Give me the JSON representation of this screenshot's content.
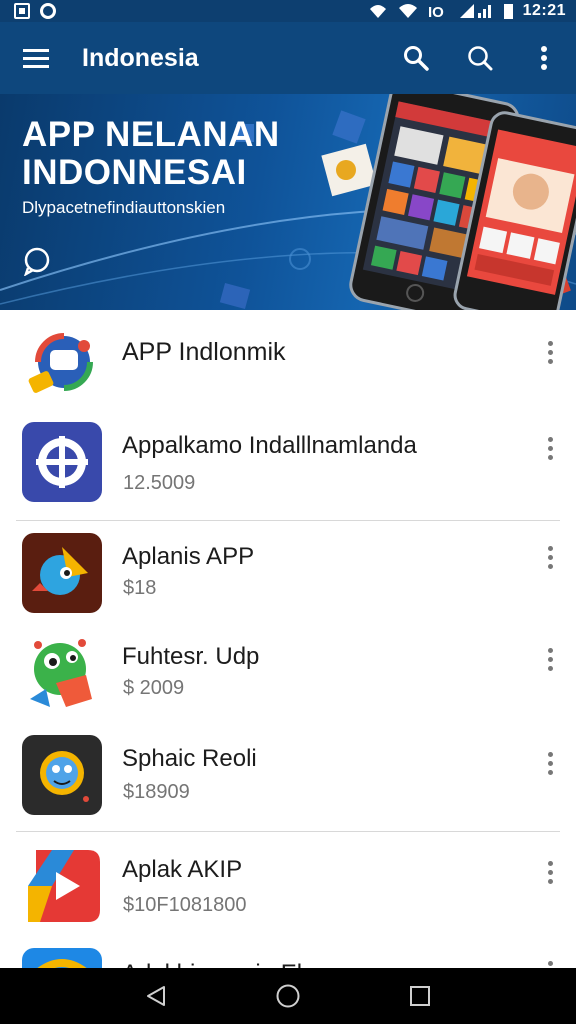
{
  "status_bar": {
    "time": "12:21",
    "left_icons": [
      "screenshot-icon",
      "sync-icon"
    ],
    "right_icons": [
      "wifi-calling-icon",
      "wifi-icon",
      "alarm-icon",
      "signal-icon",
      "battery-icon"
    ]
  },
  "toolbar": {
    "title": "Indonesia",
    "menu_icon": "hamburger-menu-icon",
    "actions": [
      "search-icon",
      "search-icon",
      "more-vert-icon"
    ]
  },
  "banner": {
    "title_line1": "APP NELANAN",
    "title_line2": "INDONNESAI",
    "subtitle": "Dlypacetnefindiauttonskien",
    "colors": {
      "dark": "#0a3a6c",
      "mid": "#1565b0"
    }
  },
  "apps": [
    {
      "name": "APP  Indlonmik",
      "price": "",
      "icon": "chat-bubbles-app-icon"
    },
    {
      "name": "Appalkamo Indalllnamlanda",
      "price": "12.5009",
      "icon": "globe-compass-app-icon"
    },
    {
      "name": "Aplanis APP",
      "price": "$18",
      "icon": "bird-app-icon"
    },
    {
      "name": "Fuhtesr. Udp",
      "price": "$ 2009",
      "icon": "green-monster-app-icon"
    },
    {
      "name": "Sphaic Reoli",
      "price": "$18909",
      "icon": "blue-creature-app-icon"
    },
    {
      "name": "Aplak AKIP",
      "price": "$10F1081800",
      "icon": "red-play-app-icon"
    },
    {
      "name": "Arlakbigamaiu  Eloe",
      "price": "",
      "icon": "blue-arc-app-icon"
    }
  ],
  "nav_bar": {
    "buttons": [
      "back-icon",
      "home-icon",
      "recents-icon"
    ]
  },
  "accent": "#0e477d"
}
